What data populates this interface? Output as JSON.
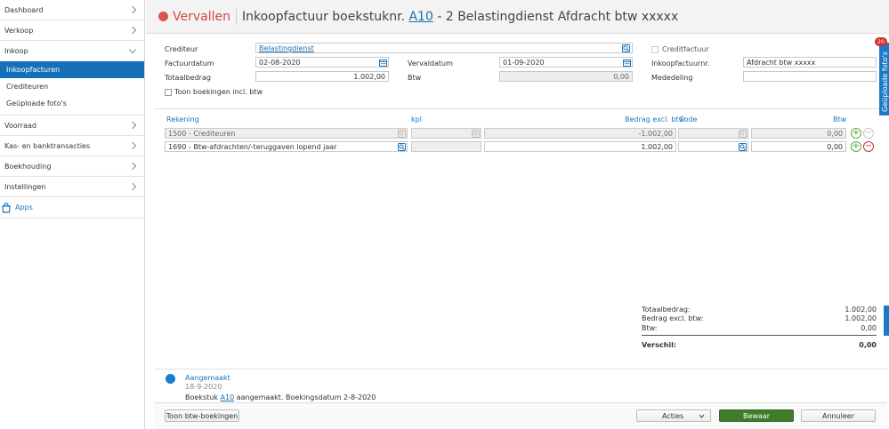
{
  "sidebar": {
    "items_top": [
      {
        "label": "Dashboard"
      },
      {
        "label": "Verkoop"
      },
      {
        "label": "Inkoop"
      }
    ],
    "sub_items": [
      {
        "label": "Inkoopfacturen",
        "active": true
      },
      {
        "label": "Crediteuren"
      },
      {
        "label": "Geüploade foto's"
      }
    ],
    "items_bottom": [
      {
        "label": "Voorraad"
      },
      {
        "label": "Kas- en banktransacties"
      },
      {
        "label": "Boekhouding"
      },
      {
        "label": "Instellingen"
      }
    ],
    "apps_label": "Apps"
  },
  "header": {
    "status": "Vervallen",
    "title_prefix": "Inkoopfactuur boekstuknr.",
    "doc_number": "A10",
    "title_suffix": "- 2 Belastingdienst Afdracht btw xxxxx"
  },
  "form": {
    "crediteur_label": "Crediteur",
    "crediteur_value": "Belastingdienst",
    "creditfactuur_label": "Creditfactuur",
    "factuurdatum_label": "Factuurdatum",
    "factuurdatum_value": "02-08-2020",
    "vervaldatum_label": "Vervaldatum",
    "vervaldatum_value": "01-09-2020",
    "inkoopfactuurnr_label": "Inkoopfactuurnr.",
    "inkoopfactuurnr_value": "Afdracht btw xxxxx",
    "totaalbedrag_label": "Totaalbedrag",
    "totaalbedrag_value": "1.002,00",
    "btw_label": "Btw",
    "btw_value": "0,00",
    "mededeling_label": "Mededeling",
    "mededeling_value": "",
    "toon_btw_label": "Toon boekingen incl. btw"
  },
  "table": {
    "headers": {
      "rekening": "Rekening",
      "kpl": "kpl",
      "bedrag": "Bedrag excl. btw",
      "code": "Code",
      "btw": "Btw"
    },
    "rows": [
      {
        "rekening": "1500 - Crediteuren",
        "kpl": "",
        "bedrag": "-1.002,00",
        "code": "",
        "btw": "0,00"
      },
      {
        "rekening": "1690 - Btw-afdrachten/-teruggaven lopend jaar",
        "kpl": "",
        "bedrag": "1.002,00",
        "code": "",
        "btw": "0,00"
      }
    ]
  },
  "summary": {
    "totaal_label": "Totaalbedrag:",
    "totaal_value": "1.002,00",
    "excl_label": "Bedrag excl. btw:",
    "excl_value": "1.002,00",
    "btw_label": "Btw:",
    "btw_value": "0,00",
    "verschil_label": "Verschil:",
    "verschil_value": "0,00"
  },
  "timeline": {
    "title": "Aangemaakt",
    "date": "18-9-2020",
    "text_prefix": "Boekstuk",
    "link": "A10",
    "text_suffix": "aangemaakt. Boekingsdatum 2-8-2020"
  },
  "footer": {
    "toon_btw_button": "Toon btw-boekingen",
    "acties_button": "Acties",
    "bewaar_button": "Bewaar",
    "annuleer_button": "Annuleer"
  },
  "side_tab": {
    "label": "Geüploade foto's",
    "badge": "20"
  },
  "colors": {
    "accent": "#1670b9",
    "status_red": "#d24a43",
    "save_green": "#3f7d2a"
  }
}
